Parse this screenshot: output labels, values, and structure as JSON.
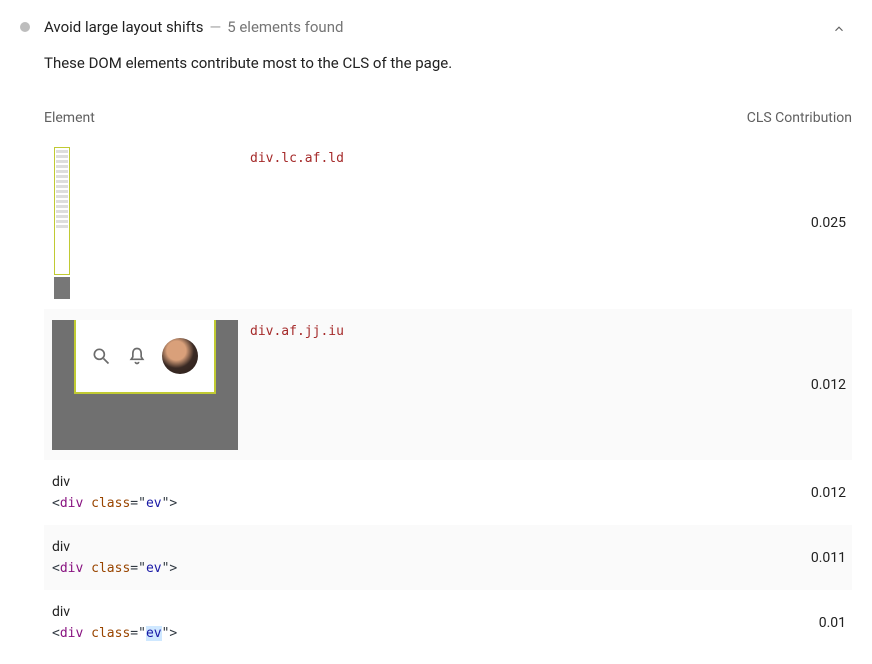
{
  "audit": {
    "title": "Avoid large layout shifts",
    "separator": "—",
    "subtitle": "5 elements found",
    "description": "These DOM elements contribute most to the CLS of the page."
  },
  "columns": {
    "element": "Element",
    "contribution": "CLS Contribution"
  },
  "rows": [
    {
      "selector": "div.lc.af.ld",
      "value": "0.025",
      "kind": "thumb1",
      "alt": false
    },
    {
      "selector": "div.af.jj.iu",
      "value": "0.012",
      "kind": "thumb2",
      "alt": true
    },
    {
      "name": "div",
      "code_prefix": "<",
      "code_tag": "div ",
      "code_attr": "class",
      "code_eq": "=\"",
      "code_str": "ev",
      "code_suffix": "\">",
      "value": "0.012",
      "kind": "simple",
      "alt": false,
      "highlight": false
    },
    {
      "name": "div",
      "code_prefix": "<",
      "code_tag": "div ",
      "code_attr": "class",
      "code_eq": "=\"",
      "code_str": "ev",
      "code_suffix": "\">",
      "value": "0.011",
      "kind": "simple",
      "alt": true,
      "highlight": false
    },
    {
      "name": "div",
      "code_prefix": "<",
      "code_tag": "div ",
      "code_attr": "class",
      "code_eq": "=\"",
      "code_str": "ev",
      "code_suffix": "\">",
      "value": "0.01",
      "kind": "simple",
      "alt": false,
      "highlight": true
    }
  ]
}
